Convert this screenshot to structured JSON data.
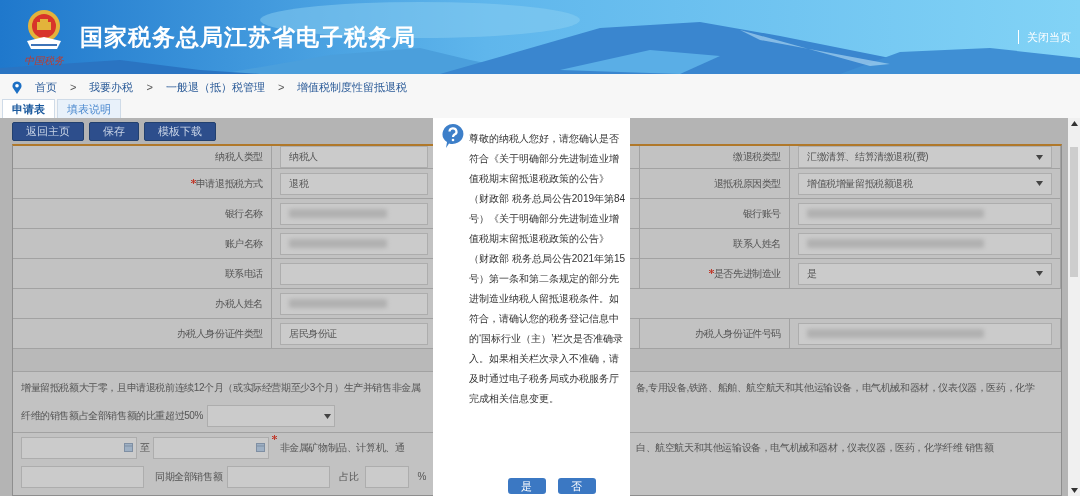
{
  "header": {
    "logo_caption": "中国税务",
    "title": "国家税务总局江苏省电子税务局",
    "close_link": "关闭当页"
  },
  "breadcrumb": [
    "首页",
    "我要办税",
    "一般退（抵）税管理",
    "增值税制度性留抵退税"
  ],
  "breadcrumb_separators": [
    ">",
    ">",
    ">"
  ],
  "tabs": [
    {
      "label": "申请表",
      "selected": true
    },
    {
      "label": "填表说明",
      "selected": false
    }
  ],
  "toolbar": [
    "返回主页",
    "保存",
    "模板下载"
  ],
  "form": {
    "rows": [
      {
        "cells": [
          {
            "label": "纳税人类型",
            "required": false,
            "field": {
              "kind": "text",
              "value": "纳税人"
            }
          },
          {
            "label": "缴退税类型",
            "required": false,
            "field": {
              "kind": "select",
              "value": "汇缴清算、结算清缴退税(费)"
            }
          }
        ]
      },
      {
        "cells": [
          {
            "label": "申请退抵税方式",
            "required": true,
            "field": {
              "kind": "text",
              "value": "退税"
            }
          },
          {
            "label": "退抵税原因类型",
            "required": false,
            "field": {
              "kind": "select",
              "value": "增值税增量留抵税额退税"
            }
          }
        ]
      },
      {
        "cells": [
          {
            "label": "银行名称",
            "required": false,
            "field": {
              "kind": "blurred"
            }
          },
          {
            "label": "银行账号",
            "required": false,
            "field": {
              "kind": "blurred"
            }
          }
        ]
      },
      {
        "cells": [
          {
            "label": "账户名称",
            "required": false,
            "field": {
              "kind": "blurred"
            }
          },
          {
            "label": "联系人姓名",
            "required": false,
            "field": {
              "kind": "blurred"
            }
          }
        ]
      },
      {
        "cells": [
          {
            "label": "联系电话",
            "required": false,
            "field": {
              "kind": "text"
            }
          },
          {
            "label": "是否先进制造业",
            "required": true,
            "field": {
              "kind": "select",
              "value": "是"
            }
          }
        ]
      },
      {
        "cells": [
          {
            "label": "办税人姓名",
            "required": false,
            "field": {
              "kind": "blurred"
            }
          }
        ]
      },
      {
        "cells": [
          {
            "label": "办税人身份证件类型",
            "required": false,
            "field": {
              "kind": "text",
              "value": "居民身份证"
            }
          },
          {
            "label": "办税人身份证件号码",
            "required": false,
            "field": {
              "kind": "blurred"
            }
          }
        ]
      }
    ],
    "condition": {
      "text_left": "增量留抵税额大于零，且申请退税前连续12个月（或实际经营期至少3个月）生产并销售非金属",
      "text_right": "备,专用设备,铁路、船舶、航空航天和其他运输设备，电气机械和器材，仪表仪器，医药，化学",
      "text_line2": "纤维的销售额占全部销售额的比重超过50%"
    },
    "period": {
      "to": "至",
      "note_left": "非金属矿物制品、计算机、通",
      "note_right": "白、航空航天和其他运输设备，电气机械和器材，仪表仪器，医药，化学纤维 销售额"
    },
    "sales": {
      "total_label": "同期全部销售额",
      "ratio_label": "占比",
      "percent": "%"
    }
  },
  "dialog": {
    "message": "尊敬的纳税人您好，请您确认是否符合《关于明确部分先进制造业增值税期末留抵退税政策的公告》（财政部 税务总局公告2019年第84号）《关于明确部分先进制造业增值税期末留抵退税政策的公告》（财政部 税务总局公告2021年第15号）第一条和第二条规定的部分先进制造业纳税人留抵退税条件。如符合，请确认您的税务登记信息中的‘国标行业（主）’栏次是否准确录入。如果相关栏次录入不准确，请及时通过电子税务局或办税服务厅完成相关信息变更。",
    "buttons": [
      "是",
      "否"
    ]
  }
}
